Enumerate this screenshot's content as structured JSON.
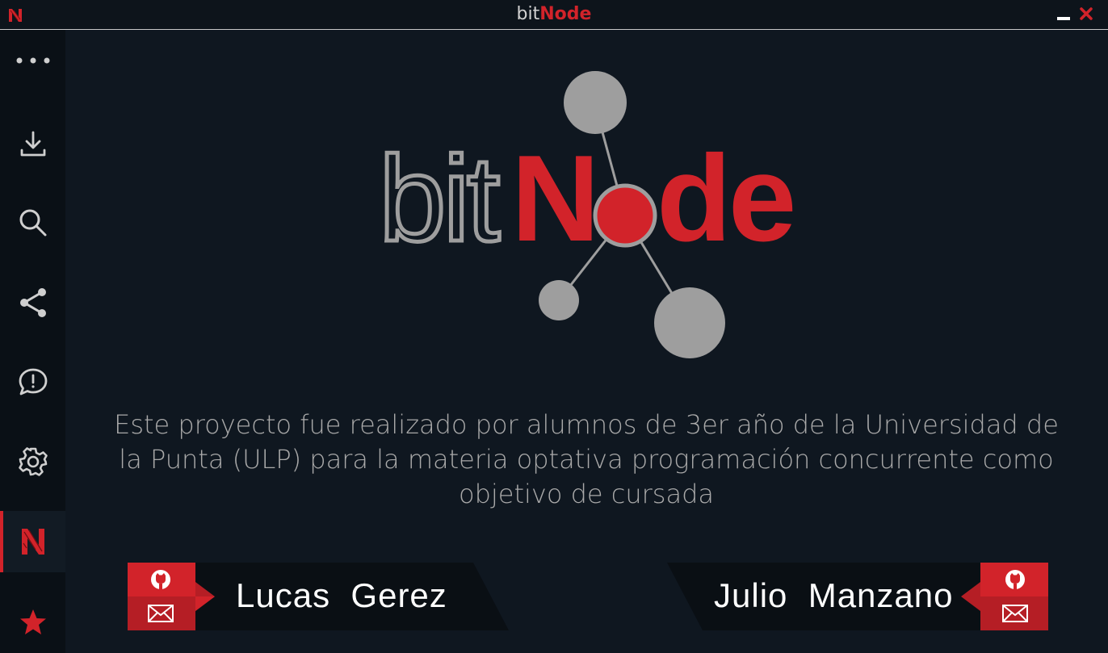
{
  "window": {
    "title_prefix": "bit",
    "title_suffix": "Node"
  },
  "sidebar": {
    "items": [
      {
        "name": "more-icon"
      },
      {
        "name": "download-icon"
      },
      {
        "name": "search-icon"
      },
      {
        "name": "share-icon"
      },
      {
        "name": "feedback-icon"
      },
      {
        "name": "settings-icon"
      },
      {
        "name": "about-icon",
        "active": true
      },
      {
        "name": "star-icon"
      }
    ]
  },
  "logo": {
    "text_prefix": "bit",
    "text_suffix_n": "N",
    "text_suffix_de": "de"
  },
  "about": {
    "description": "Este proyecto fue realizado por alumnos de 3er año de la Universidad de la Punta (ULP) para la materia optativa programación concurrente como objetivo de cursada"
  },
  "authors": [
    {
      "name": "Lucas  Gerez"
    },
    {
      "name": "Julio  Manzano"
    }
  ],
  "colors": {
    "accent": "#d2232a",
    "background": "#0f1720",
    "sidebar": "#0a1016",
    "node_gray": "#9e9e9e"
  }
}
